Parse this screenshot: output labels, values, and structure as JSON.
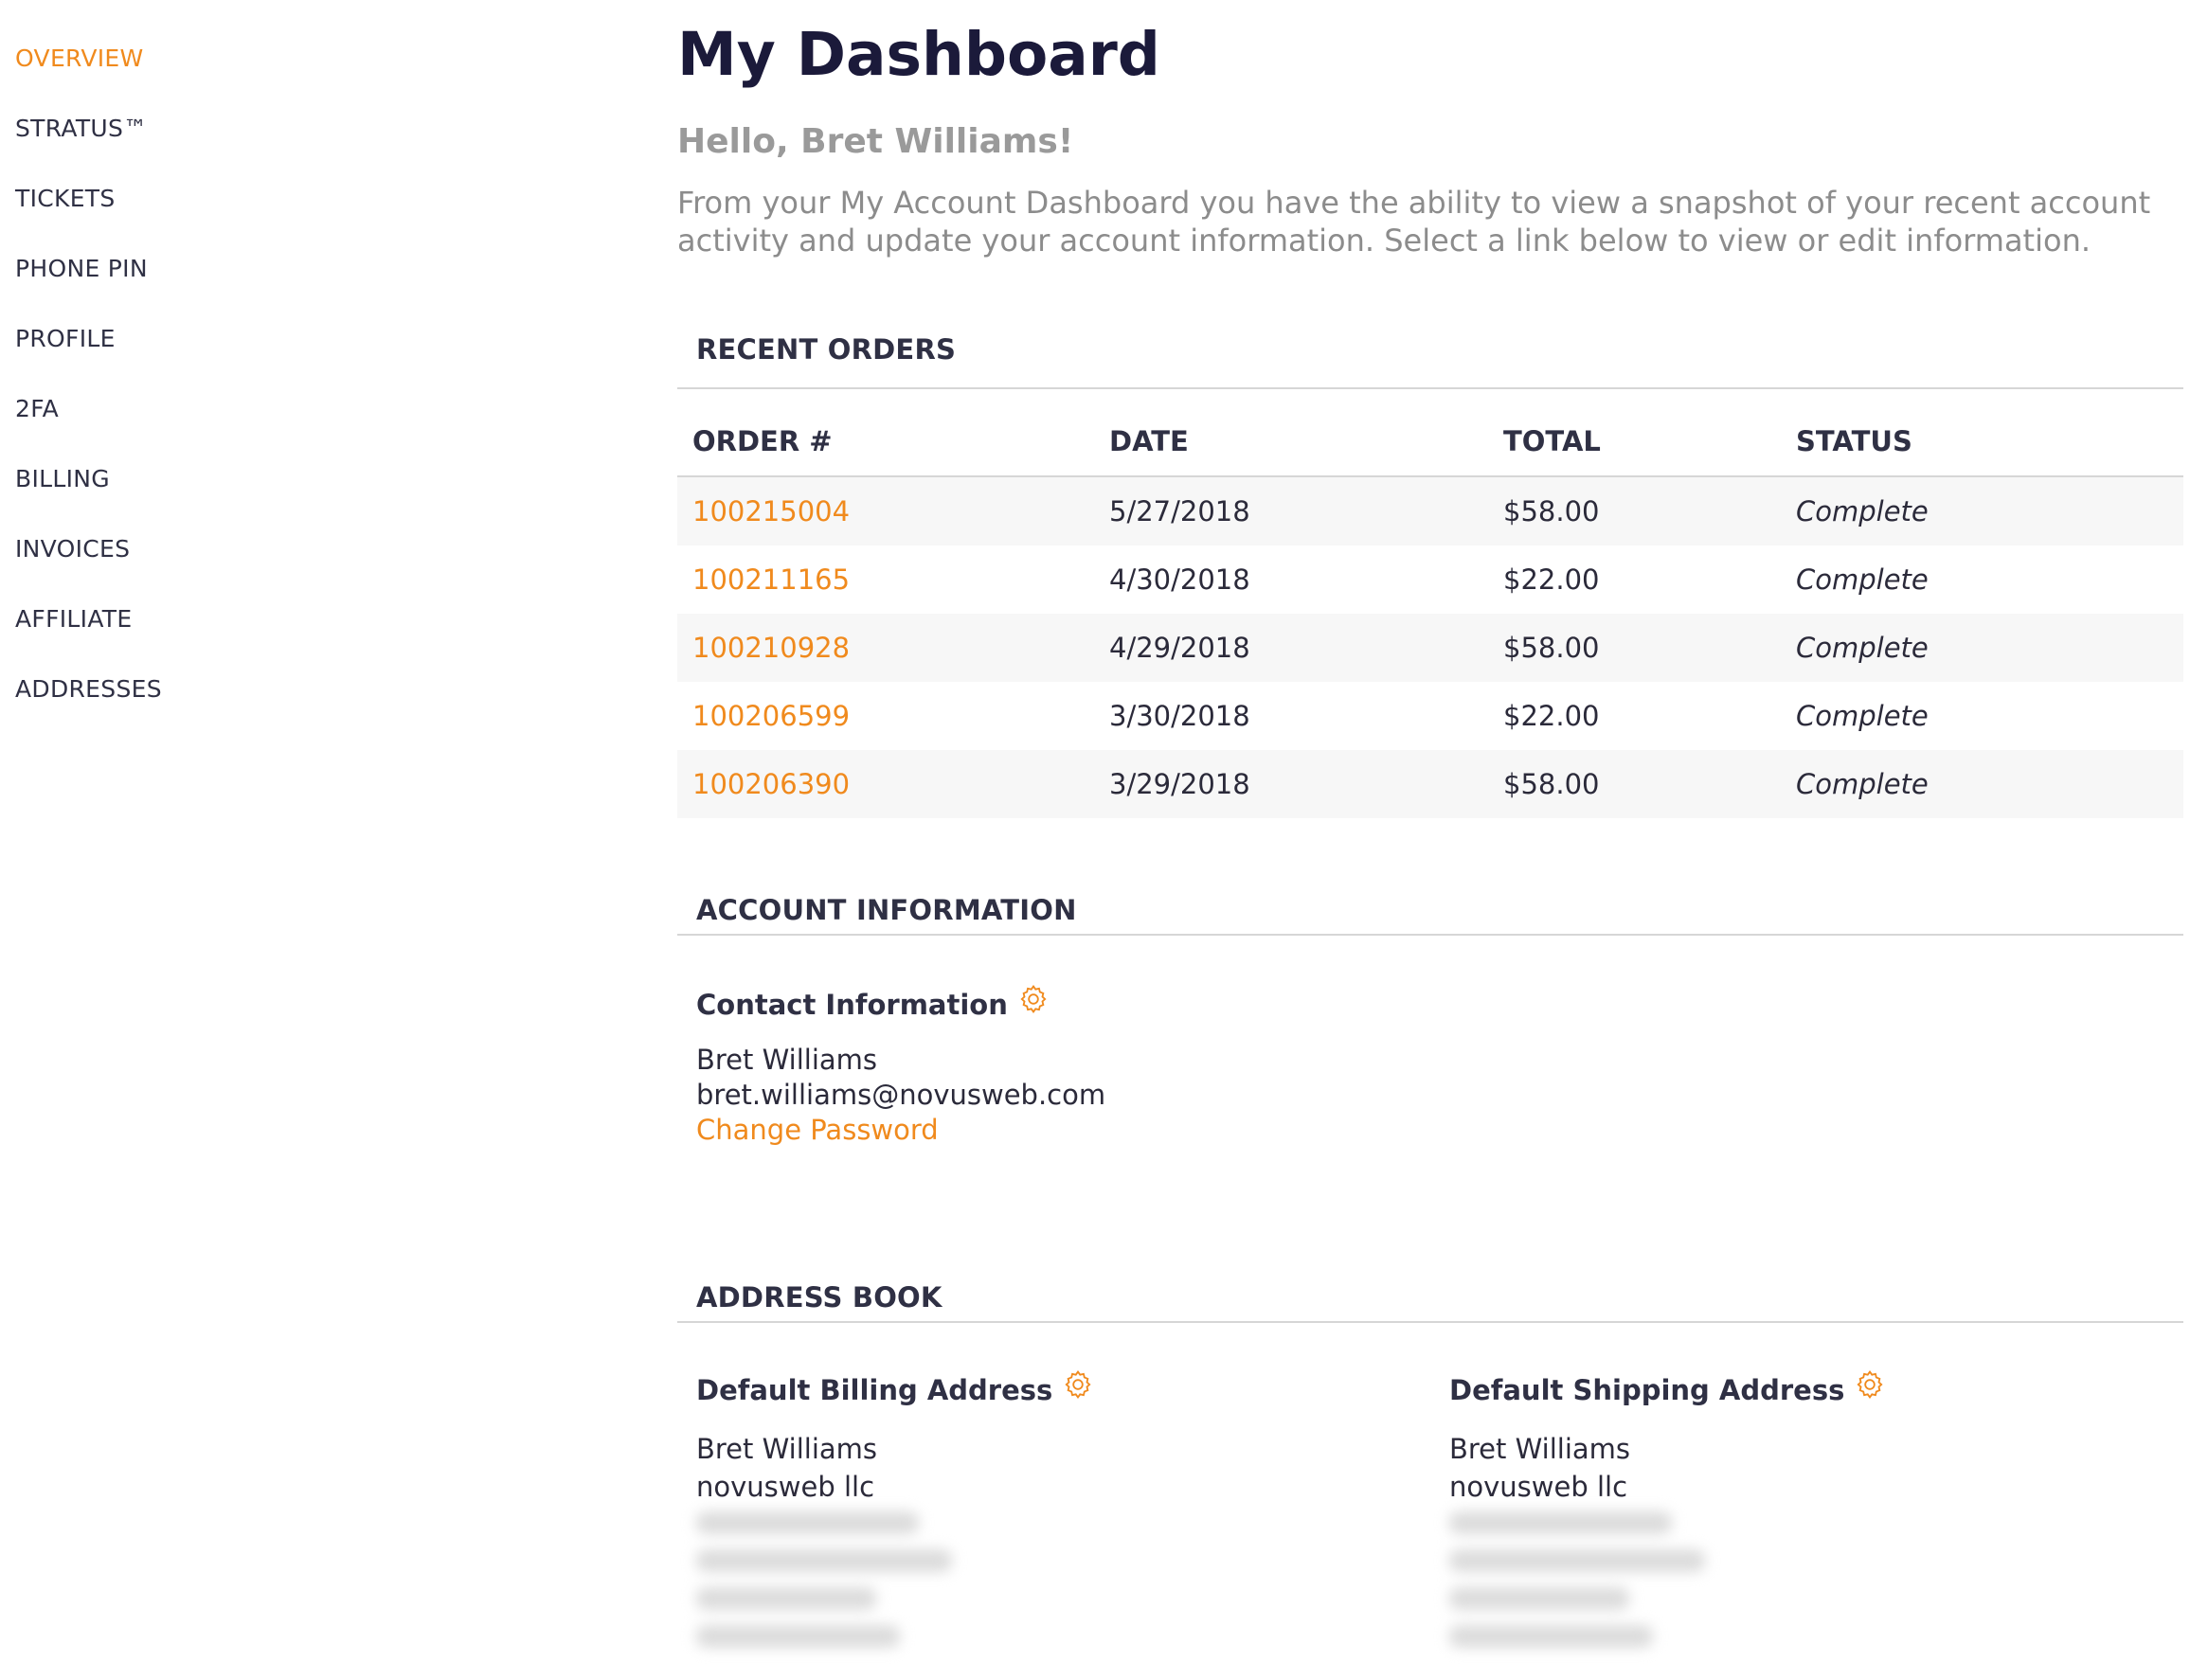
{
  "sidebar": {
    "items": [
      {
        "label": "OVERVIEW",
        "active": true
      },
      {
        "label": "STRATUS™",
        "active": false
      },
      {
        "label": "TICKETS",
        "active": false
      },
      {
        "label": "PHONE PIN",
        "active": false
      },
      {
        "label": "PROFILE",
        "active": false
      },
      {
        "label": "2FA",
        "active": false
      },
      {
        "label": "BILLING",
        "active": false
      },
      {
        "label": "INVOICES",
        "active": false
      },
      {
        "label": "AFFILIATE",
        "active": false
      },
      {
        "label": "ADDRESSES",
        "active": false
      }
    ]
  },
  "main": {
    "title": "My Dashboard",
    "greeting": "Hello, Bret Williams!",
    "intro": "From your My Account Dashboard you have the ability to view a snapshot of your recent account activity and update your account information. Select a link below to view or edit information."
  },
  "recent_orders": {
    "title": "RECENT ORDERS",
    "columns": [
      "ORDER #",
      "DATE",
      "TOTAL",
      "STATUS"
    ],
    "rows": [
      {
        "order": "100215004",
        "date": "5/27/2018",
        "total": "$58.00",
        "status": "Complete"
      },
      {
        "order": "100211165",
        "date": "4/30/2018",
        "total": "$22.00",
        "status": "Complete"
      },
      {
        "order": "100210928",
        "date": "4/29/2018",
        "total": "$58.00",
        "status": "Complete"
      },
      {
        "order": "100206599",
        "date": "3/30/2018",
        "total": "$22.00",
        "status": "Complete"
      },
      {
        "order": "100206390",
        "date": "3/29/2018",
        "total": "$58.00",
        "status": "Complete"
      }
    ]
  },
  "account_information": {
    "title": "ACCOUNT INFORMATION",
    "contact": {
      "heading": "Contact Information",
      "name": "Bret Williams",
      "email": "bret.williams@novusweb.com",
      "change_password": "Change Password"
    }
  },
  "address_book": {
    "title": "ADDRESS BOOK",
    "billing": {
      "heading": "Default Billing Address",
      "name": "Bret Williams",
      "company": "novusweb llc"
    },
    "shipping": {
      "heading": "Default Shipping Address",
      "name": "Bret Williams",
      "company": "novusweb llc"
    }
  },
  "colors": {
    "accent": "#f08a1d",
    "title": "#1b1a3a",
    "muted": "#8c8c8c",
    "stripe": "#f7f7f7"
  },
  "icons": {
    "settings": "gear-icon"
  }
}
